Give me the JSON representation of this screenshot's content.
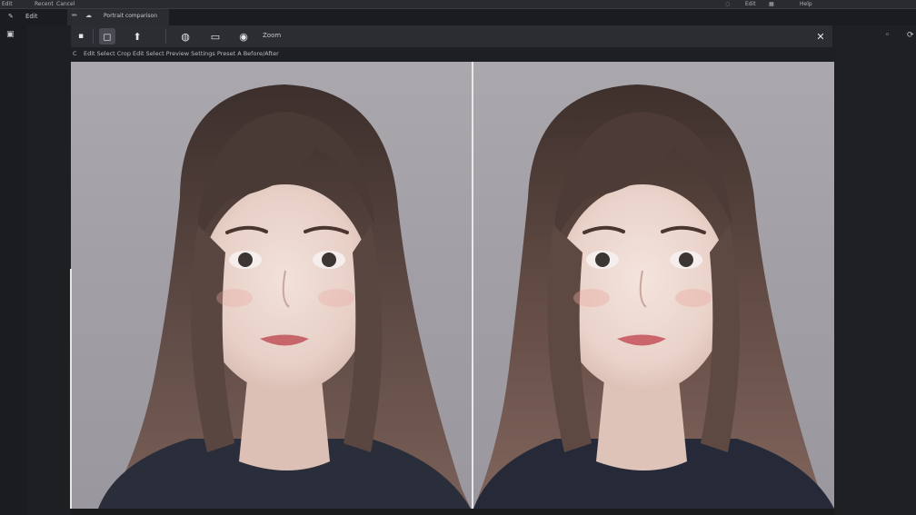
{
  "topbar": {
    "items": [
      "Edit",
      "Recent",
      "Cancel"
    ],
    "right_items": [
      "Edit",
      "Help"
    ]
  },
  "tabs": {
    "file_tab_label": "Portrait comparison"
  },
  "toolbar": {
    "zoom_label": "Zoom"
  },
  "infobar": {
    "text_left": "C",
    "text": "Edit Select Crop  Edit Select Preview Settings Preset A Before/After"
  },
  "icons": {
    "menu": "menu-icon",
    "edit": "pencil-icon",
    "square": "square-icon",
    "arrow": "arrow-up-icon",
    "circle": "circle-icon",
    "frame": "frame-icon",
    "color": "color-icon",
    "close": "close-icon",
    "search": "search-icon"
  },
  "colors": {
    "background": "#1e1f22",
    "toolbar": "#2c2d32",
    "divider": "#e9e9ea"
  }
}
